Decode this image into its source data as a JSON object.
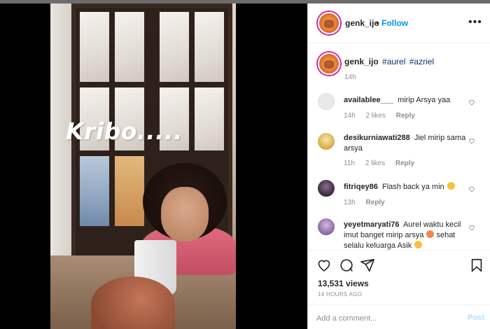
{
  "post": {
    "owner": "genk_ijo",
    "follow_label": "Follow",
    "separator": "•",
    "more_icon": "more-horizontal-icon",
    "video_overlay_text": "Kribo.....",
    "caption": {
      "username": "genk_ijo",
      "hashtags": [
        "#aurel",
        "#azriel"
      ],
      "time": "14h"
    },
    "comments": [
      {
        "username": "availablee___",
        "text": "mirip Arsya yaa",
        "time": "14h",
        "likes": "2 likes",
        "reply": "Reply",
        "avatar_color": "#e8e8e8"
      },
      {
        "username": "desikurniawati288",
        "text": "Jiel mirip sama arsya",
        "time": "11h",
        "likes": "2 likes",
        "reply": "Reply",
        "avatar_color": "#f0d9a0"
      },
      {
        "username": "fitriqey86",
        "text": "Flash back ya min",
        "time": "13h",
        "likes": "",
        "reply": "Reply",
        "avatar_color": "#4a3a52"
      },
      {
        "username": "yeyetmaryati76",
        "text": "Aurel waktu kecil imut banget mirip arsya",
        "text2": "sehat selalu keluarga Asik",
        "time": "",
        "likes": "",
        "reply": "",
        "avatar_color": "#8c6fa8"
      }
    ],
    "views": "13,531 views",
    "posted_ago": "14 HOURS AGO",
    "add_comment_placeholder": "Add a comment...",
    "post_label": "Post"
  },
  "colors": {
    "accent": "#0095f6",
    "hashtag": "#00376b",
    "muted": "#8e8e8e"
  }
}
